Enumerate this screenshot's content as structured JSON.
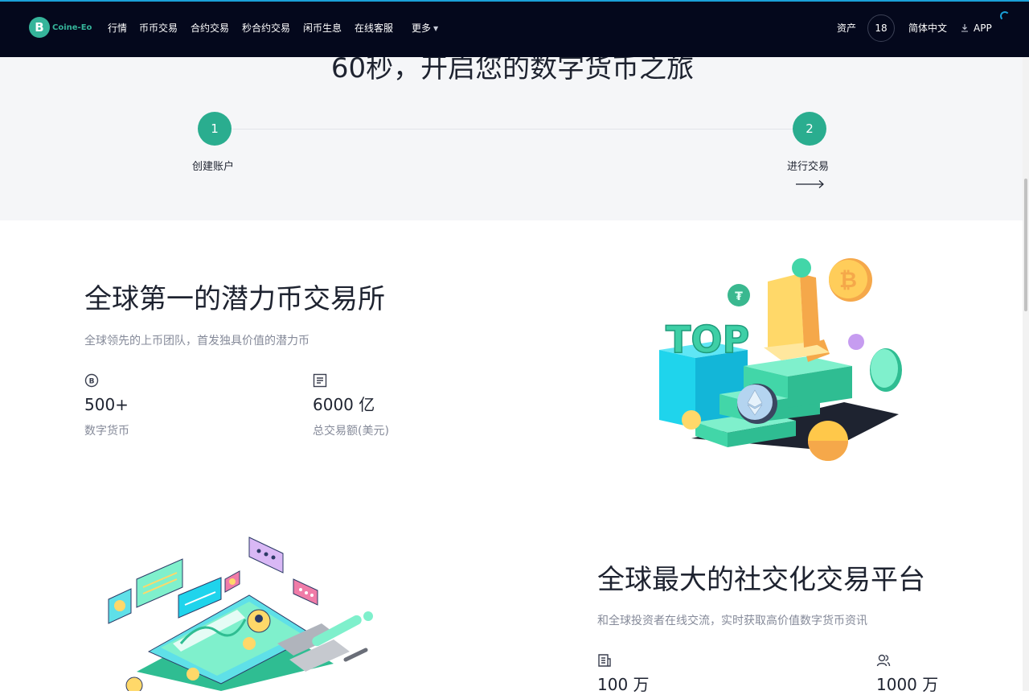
{
  "nav": {
    "logo_letter": "B",
    "logo_text": "Coine-Eo",
    "items": [
      "行情",
      "币币交易",
      "合约交易",
      "秒合约交易",
      "闲币生息",
      "在线客服",
      "更多"
    ],
    "assets": "资产",
    "badge": "18",
    "language": "简体中文",
    "app": "APP"
  },
  "hero": {
    "title": "60秒，开启您的数字货币之旅",
    "steps": [
      {
        "num": "1",
        "label": "创建账户"
      },
      {
        "num": "2",
        "label": "进行交易"
      }
    ]
  },
  "section1": {
    "title": "全球第一的潜力币交易所",
    "subtitle": "全球领先的上币团队，首发独具价值的潜力币",
    "stats": [
      {
        "icon": "coin-icon",
        "value": "500+",
        "label": "数字货币"
      },
      {
        "icon": "document-icon",
        "value": "6000 亿",
        "label": "总交易额(美元)"
      }
    ],
    "illustration_text": "TOP"
  },
  "section2": {
    "title": "全球最大的社交化交易平台",
    "subtitle": "和全球投资者在线交流，实时获取高价值数字货币资讯",
    "stats": [
      {
        "icon": "news-icon",
        "value": "100 万"
      },
      {
        "icon": "users-icon",
        "value": "1000 万"
      }
    ]
  },
  "colors": {
    "nav_bg": "#04081c",
    "accent": "#2aad8f",
    "brand_green": "#35b49a",
    "section_bg": "#f5f6f8"
  }
}
